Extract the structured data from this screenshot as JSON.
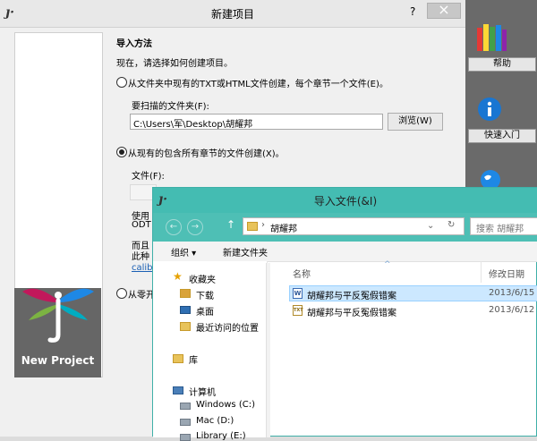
{
  "background_dialog": {
    "title": "新建项目",
    "help_mark": "?",
    "minimize_mark": "−",
    "close_mark": "×",
    "section_title": "导入方法",
    "instruction": "现在，请选择如何创建项目。",
    "option1_label": "从文件夹中现有的TXT或HTML文件创建，每个章节一个文件(E)。",
    "scan_folder_label": "要扫描的文件夹(F):",
    "scan_folder_value": "C:\\Users\\军\\Desktop\\胡耀邦",
    "browse_label": "浏览(W)",
    "option2_label": "从现有的包含所有章节的文件创建(X)。",
    "file_label": "文件(F):",
    "partial_text_1": "使用",
    "partial_text_2": "ODT",
    "partial_text_3": "而且",
    "partial_text_4": "此种",
    "partial_link": "calib",
    "option3_label": "从零开",
    "banner_text": "New Project"
  },
  "right_panel": {
    "help_label": "帮助",
    "quickstart_label": "快速入门"
  },
  "import_dialog": {
    "title": "导入文件(&I)",
    "breadcrumb_sep": "›",
    "folder_path": "胡耀邦",
    "search_placeholder": "搜索 胡耀邦",
    "toolbar": {
      "organize": "组织 ▾",
      "new_folder": "新建文件夹"
    },
    "nav": {
      "favorites": "收藏夹",
      "downloads": "下载",
      "desktop": "桌面",
      "recent": "最近访问的位置",
      "library": "库",
      "computer": "计算机",
      "drive_c": "Windows (C:)",
      "drive_d": "Mac (D:)",
      "drive_e": "Library (E:)"
    },
    "columns": {
      "name": "名称",
      "modified": "修改日期"
    },
    "files": [
      {
        "name": "胡耀邦与平反冤假错案",
        "date": "2013/6/15",
        "icon": "W"
      },
      {
        "name": "胡耀邦与平反冤假错案",
        "date": "2013/6/12",
        "icon": "TXT"
      }
    ]
  }
}
